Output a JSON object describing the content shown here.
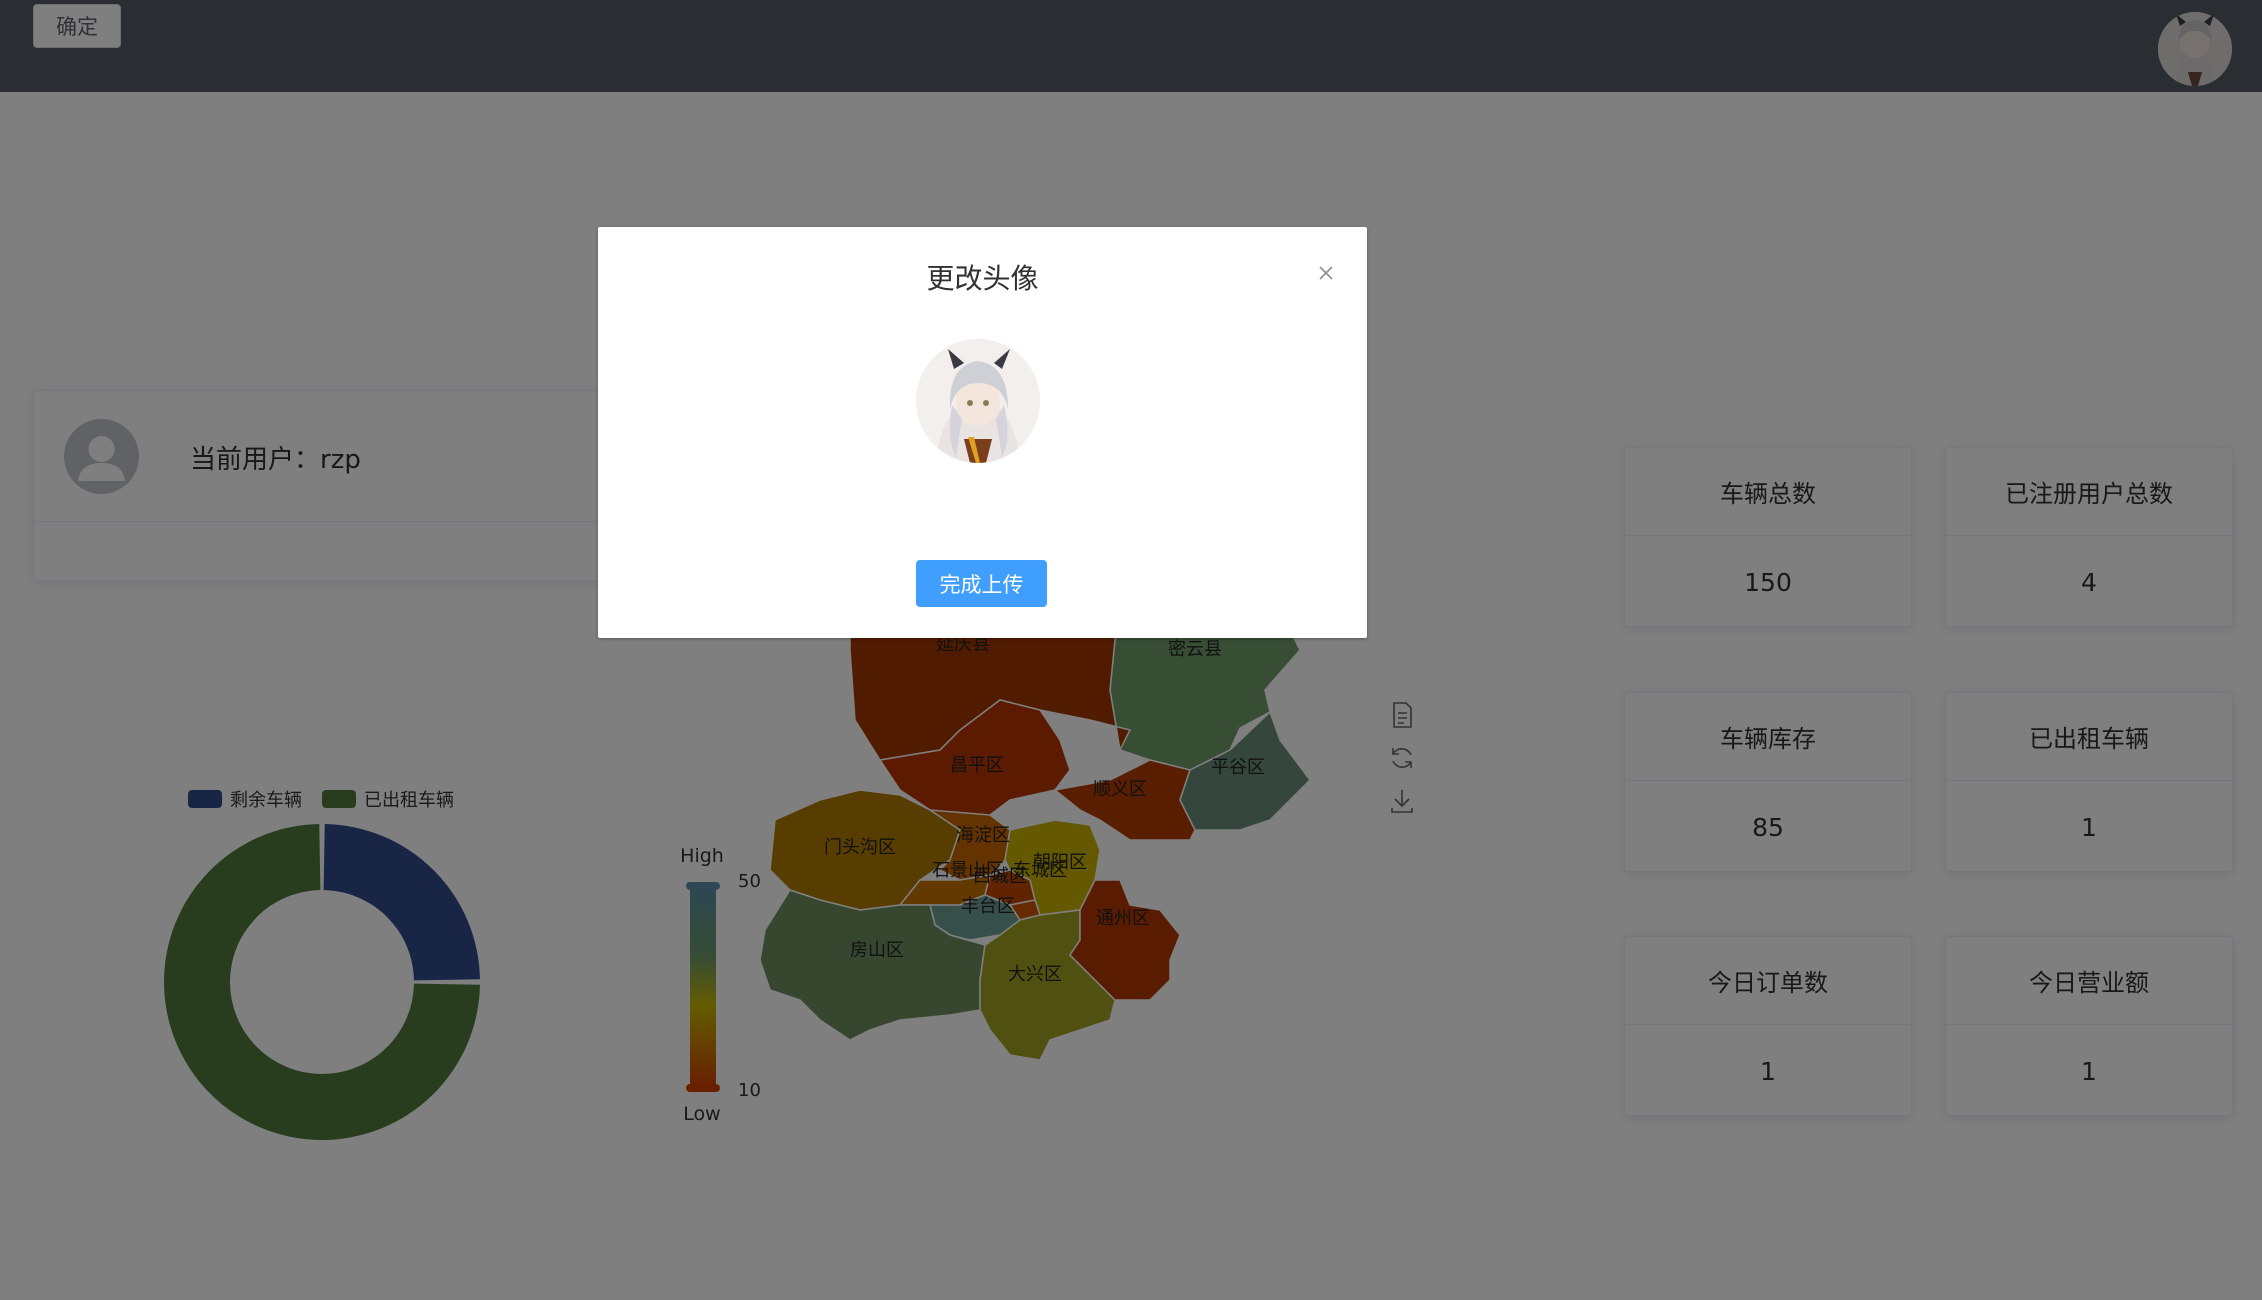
{
  "header": {
    "confirm_label": "确定",
    "avatar_alt": "avatar"
  },
  "user_card": {
    "label": "当前用户：rzp"
  },
  "stats": [
    {
      "title": "车辆总数",
      "value": "150"
    },
    {
      "title": "已注册用户总数",
      "value": "4"
    },
    {
      "title": "车辆库存",
      "value": "85"
    },
    {
      "title": "已出租车辆",
      "value": "1"
    },
    {
      "title": "今日订单数",
      "value": "1"
    },
    {
      "title": "今日营业额",
      "value": "1"
    }
  ],
  "donut": {
    "legend": [
      "剩余车辆",
      "已出租车辆"
    ],
    "colors": [
      "#334b8b",
      "#4e7a3c"
    ]
  },
  "map": {
    "visual_map": {
      "high_label": "High",
      "low_label": "Low",
      "max": "50",
      "min": "10"
    },
    "districts": [
      "延庆县",
      "密云县",
      "昌平区",
      "顺义区",
      "平谷区",
      "门头沟区",
      "海淀区",
      "石景山区",
      "西城区",
      "东城区",
      "朝阳区",
      "丰台区",
      "房山区",
      "大兴区",
      "通州区"
    ]
  },
  "dialog": {
    "title": "更改头像",
    "upload_label": "完成上传"
  },
  "chart_data": [
    {
      "type": "pie",
      "categories": [
        "剩余车辆",
        "已出租车辆"
      ],
      "values": [
        1,
        3
      ],
      "colors": [
        "#334b8b",
        "#4e7a3c"
      ]
    }
  ]
}
